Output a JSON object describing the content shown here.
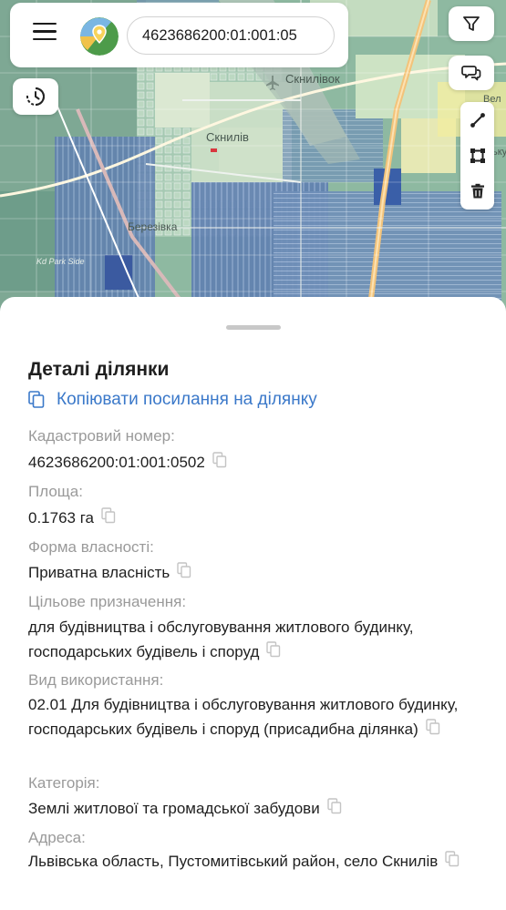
{
  "search": {
    "value": "4623686200:01:001:05"
  },
  "map_labels": {
    "place_top": "Скнилівок",
    "place_center": "Скнилів",
    "place_left": "Березівка",
    "park": "Kd Park Side",
    "right_edge_1": "Вел",
    "right_edge_2": "ьку"
  },
  "icons": {
    "menu": "menu-icon",
    "logo": "map-logo-icon",
    "history": "history-clock-icon",
    "filter": "filter-icon",
    "chat": "chat-icon",
    "line": "measure-line-icon",
    "area": "measure-area-icon",
    "delete": "trash-icon",
    "copy": "copy-icon"
  },
  "sheet": {
    "title": "Деталі ділянки",
    "copy_link": "Копіювати посилання на ділянку",
    "fields": [
      {
        "label": "Кадастровий номер:",
        "value": "4623686200:01:001:0502"
      },
      {
        "label": "Площа:",
        "value": "0.1763 га"
      },
      {
        "label": "Форма власності:",
        "value": "Приватна власність"
      },
      {
        "label": "Цільове призначення:",
        "value": "для будівництва і обслуговування житлового будинку, господарських будівель і споруд"
      },
      {
        "label": "Вид використання:",
        "value": "02.01 Для будівництва і обслуговування житлового будинку, господарських будівель і споруд (присадибна ділянка)"
      },
      {
        "label": "Категорія:",
        "value": "Землі житлової та громадської забудови"
      },
      {
        "label": "Адреса:",
        "value": "Львівська область, Пустомитівський район, село Скнилів"
      }
    ]
  },
  "colors": {
    "link": "#3a78c9",
    "label": "#9a9a9a",
    "text": "#1f1f1f"
  }
}
